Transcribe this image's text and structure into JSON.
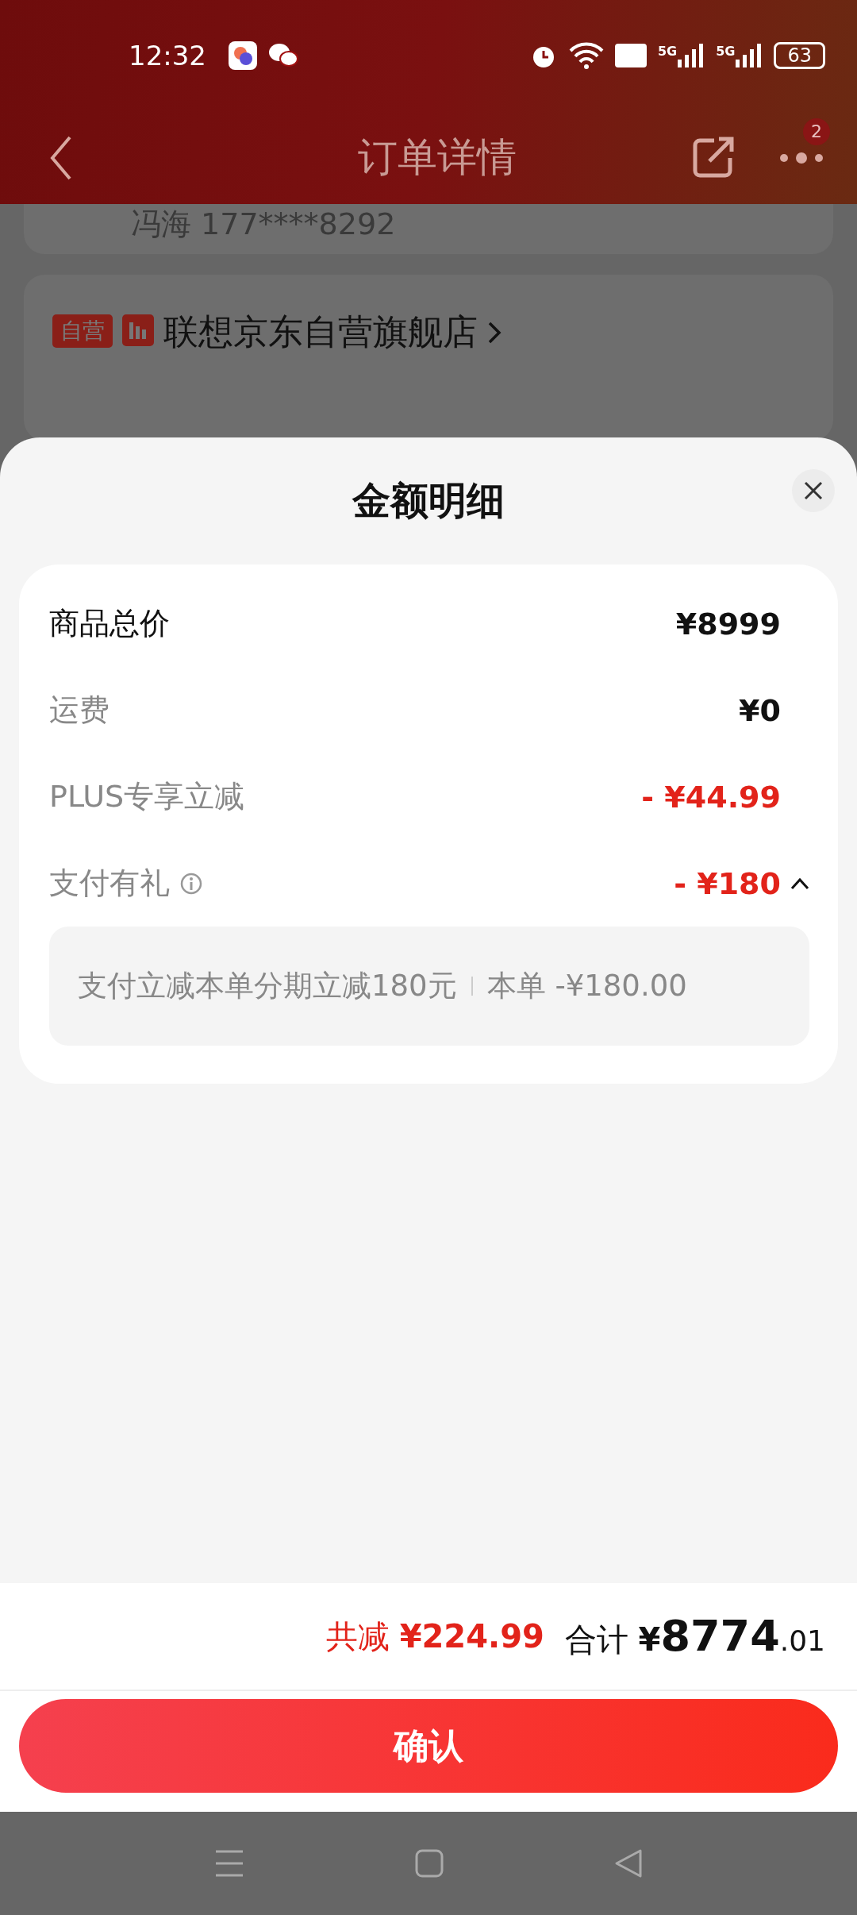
{
  "status_bar": {
    "time": "12:32",
    "networks": [
      "5G",
      "5G"
    ],
    "battery": "63"
  },
  "header": {
    "title": "订单详情",
    "badge": "2"
  },
  "background": {
    "contact": "冯海 177****8292",
    "store_tag": "自营",
    "store_name": "联想京东自营旗舰店"
  },
  "sheet": {
    "title": "金额明细",
    "rows": [
      {
        "kind": "total",
        "label": "商品总价",
        "value": "¥8999"
      },
      {
        "kind": "fee",
        "label": "运费",
        "value": "¥0"
      },
      {
        "kind": "discount",
        "label": "PLUS专享立减",
        "value": "- ¥44.99"
      },
      {
        "kind": "promo",
        "label": "支付有礼",
        "value": "- ¥180",
        "expanded": true,
        "detail": {
          "text": "支付立减本单分期立减180元",
          "amount": "本单 -¥180.00"
        }
      }
    ]
  },
  "footer": {
    "saved_label": "共减",
    "saved": "¥224.99",
    "total_label": "合计",
    "total_symbol": "¥",
    "total_int": "8774",
    "total_dec": ".01",
    "button": "确认"
  }
}
